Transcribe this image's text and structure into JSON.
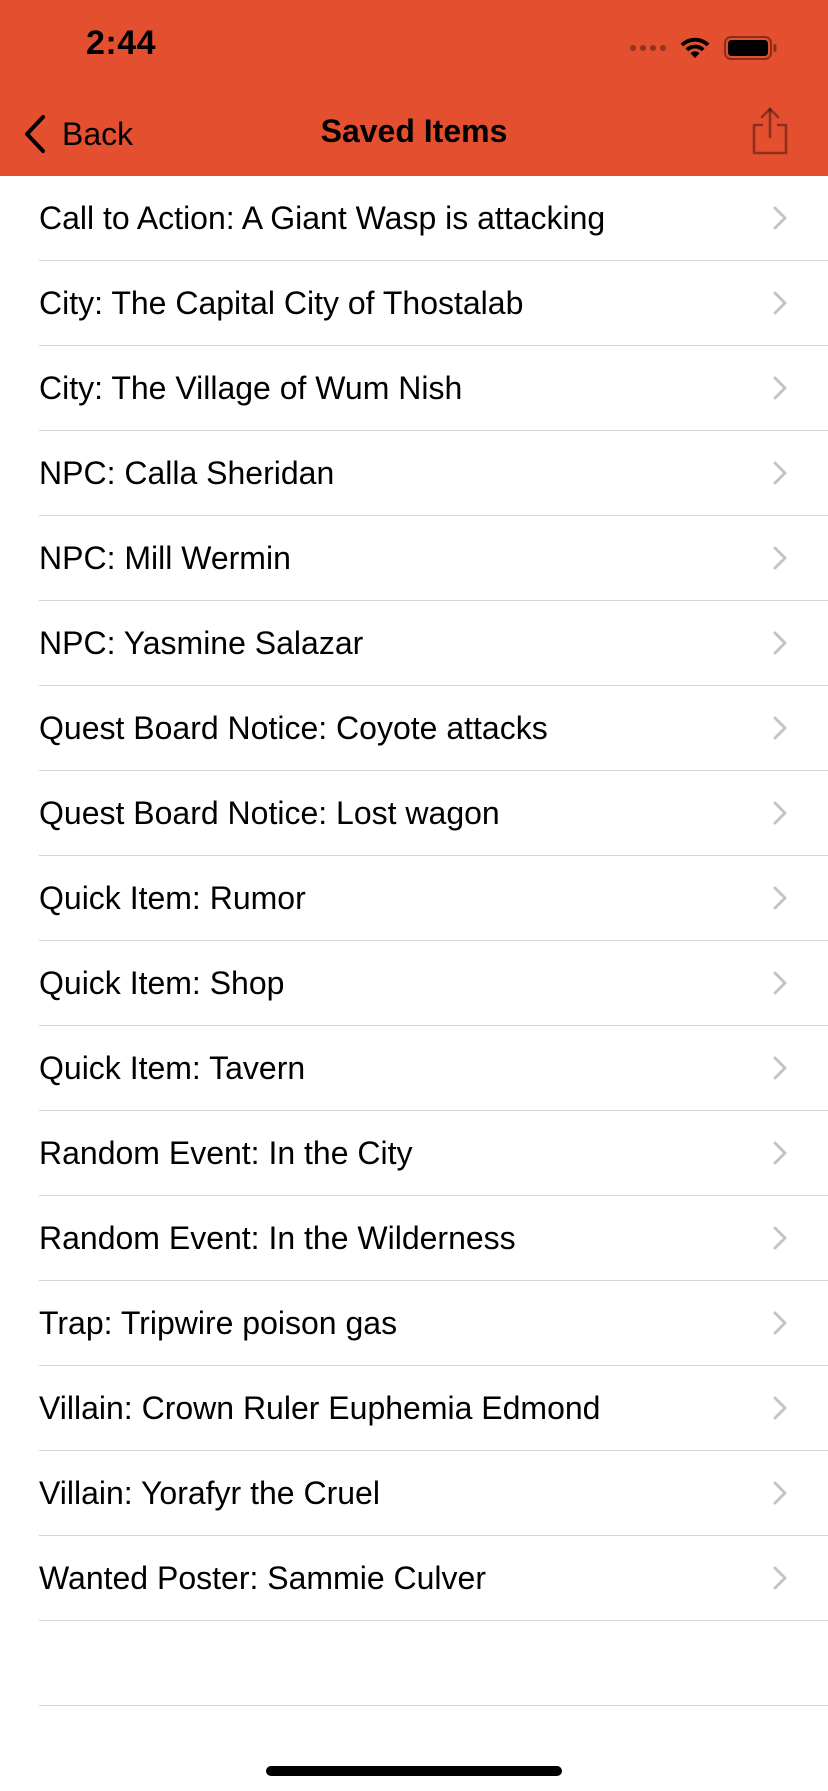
{
  "status_bar": {
    "time": "2:44"
  },
  "nav": {
    "back_label": "Back",
    "title": "Saved Items"
  },
  "colors": {
    "header": "#e44f30",
    "separator": "#d6d6d8",
    "chevron": "#c4c4c6"
  },
  "icons": {
    "back": "chevron-left-icon",
    "share": "share-icon",
    "row_disclosure": "chevron-right-icon"
  },
  "items": [
    {
      "label": "Call to Action: A Giant Wasp is attacking"
    },
    {
      "label": "City: The Capital City of Thostalab"
    },
    {
      "label": "City: The Village of Wum Nish"
    },
    {
      "label": "NPC: Calla Sheridan"
    },
    {
      "label": "NPC: Mill Wermin"
    },
    {
      "label": "NPC: Yasmine Salazar"
    },
    {
      "label": "Quest Board Notice: Coyote attacks"
    },
    {
      "label": "Quest Board Notice: Lost wagon"
    },
    {
      "label": "Quick Item: Rumor"
    },
    {
      "label": "Quick Item: Shop"
    },
    {
      "label": "Quick Item: Tavern"
    },
    {
      "label": "Random Event: In the City"
    },
    {
      "label": "Random Event: In the Wilderness"
    },
    {
      "label": "Trap: Tripwire poison gas"
    },
    {
      "label": "Villain: Crown Ruler Euphemia Edmond"
    },
    {
      "label": "Villain: Yorafyr the Cruel"
    },
    {
      "label": "Wanted Poster: Sammie Culver"
    },
    {
      "label": ""
    }
  ]
}
